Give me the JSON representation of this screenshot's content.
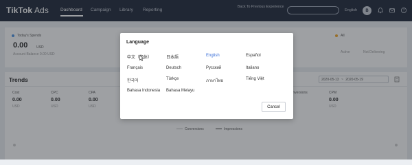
{
  "app": {
    "logo_main": "TikTok",
    "logo_sub": " Ads"
  },
  "nav": {
    "items": [
      "Dashboard",
      "Campaign",
      "Library",
      "Reporting"
    ],
    "back_link": "Back To Previous Experience",
    "language": "English",
    "avatar_initial": "B"
  },
  "summary": {
    "spend_label": "Today's Spends",
    "spend_value": "0.00",
    "spend_unit": "USD",
    "balance": "Account Balance 0.00 USD",
    "all_label": "All",
    "active_label": "Active",
    "not_delivering_label": "Not Delivering"
  },
  "trends": {
    "title": "Trends",
    "metrics": [
      {
        "label": "Cost",
        "value": "0.00",
        "unit": "USD"
      },
      {
        "label": "CPC",
        "value": "0.00",
        "unit": "USD"
      },
      {
        "label": "CPA",
        "value": "0.00",
        "unit": "USD"
      },
      {
        "label": "Conversions",
        "value": "0",
        "unit": ""
      },
      {
        "label": "CPM",
        "value": "0.00",
        "unit": "USD"
      }
    ],
    "date_start": "2020-05-13",
    "date_sep": "~",
    "date_end": "2020-05-19",
    "legend_conversions": "Conversions",
    "legend_impressions": "Impressions"
  },
  "modal": {
    "title": "Language",
    "options": [
      "中文（简体）",
      "日本語",
      "English",
      "Español",
      "Français",
      "Deutsch",
      "Русский",
      "Italiano",
      "한국어",
      "Türkçe",
      "ภาษาไทย",
      "Tiếng Việt",
      "Bahasa Indonesia",
      "Bahasa Melayu"
    ],
    "selected": "English",
    "cancel_label": "Cancel"
  },
  "colors": {
    "nav_bg": "#1b2436",
    "selected_language": "#3a6fd8",
    "spend_dot": "#4a90e2",
    "all_dot": "#f5a623"
  }
}
